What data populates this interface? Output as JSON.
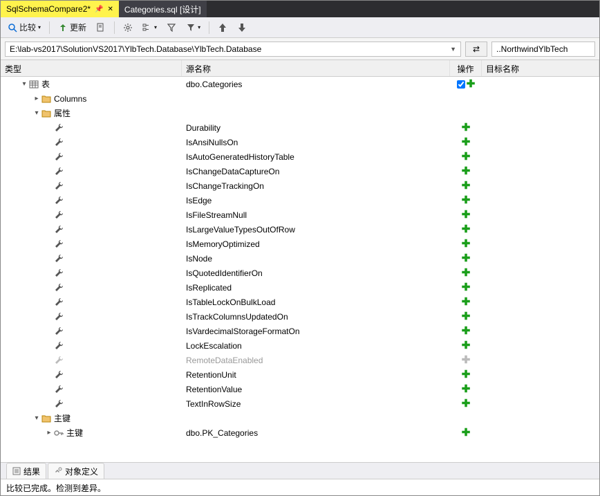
{
  "tabs": [
    {
      "label": "SqlSchemaCompare2*",
      "active": true,
      "pinned": true
    },
    {
      "label": "Categories.sql [设计]",
      "active": false
    }
  ],
  "toolbar": {
    "compare": "比较",
    "update": "更新"
  },
  "paths": {
    "source": "E:\\lab-vs2017\\SolutionVS2017\\YlbTech.Database\\YlbTech.Database",
    "target": "..NorthwindYlbTech"
  },
  "headers": {
    "type": "类型",
    "source": "源名称",
    "action": "操作",
    "target": "目标名称"
  },
  "tree": [
    {
      "depth": 0,
      "expander": "▾",
      "icon": "table-icon",
      "type_label": "表",
      "source": "dbo.Categories",
      "action": "plus",
      "check": true
    },
    {
      "depth": 1,
      "expander": "▸",
      "icon": "folder-icon",
      "type_label": "Columns",
      "source": "",
      "action": ""
    },
    {
      "depth": 1,
      "expander": "▾",
      "icon": "folder-icon",
      "type_label": "属性",
      "source": "",
      "action": ""
    },
    {
      "depth": 2,
      "expander": "",
      "icon": "wrench-icon",
      "type_label": "",
      "source": "Durability",
      "action": "plus"
    },
    {
      "depth": 2,
      "expander": "",
      "icon": "wrench-icon",
      "type_label": "",
      "source": "IsAnsiNullsOn",
      "action": "plus"
    },
    {
      "depth": 2,
      "expander": "",
      "icon": "wrench-icon",
      "type_label": "",
      "source": "IsAutoGeneratedHistoryTable",
      "action": "plus"
    },
    {
      "depth": 2,
      "expander": "",
      "icon": "wrench-icon",
      "type_label": "",
      "source": "IsChangeDataCaptureOn",
      "action": "plus"
    },
    {
      "depth": 2,
      "expander": "",
      "icon": "wrench-icon",
      "type_label": "",
      "source": "IsChangeTrackingOn",
      "action": "plus"
    },
    {
      "depth": 2,
      "expander": "",
      "icon": "wrench-icon",
      "type_label": "",
      "source": "IsEdge",
      "action": "plus"
    },
    {
      "depth": 2,
      "expander": "",
      "icon": "wrench-icon",
      "type_label": "",
      "source": "IsFileStreamNull",
      "action": "plus"
    },
    {
      "depth": 2,
      "expander": "",
      "icon": "wrench-icon",
      "type_label": "",
      "source": "IsLargeValueTypesOutOfRow",
      "action": "plus"
    },
    {
      "depth": 2,
      "expander": "",
      "icon": "wrench-icon",
      "type_label": "",
      "source": "IsMemoryOptimized",
      "action": "plus"
    },
    {
      "depth": 2,
      "expander": "",
      "icon": "wrench-icon",
      "type_label": "",
      "source": "IsNode",
      "action": "plus"
    },
    {
      "depth": 2,
      "expander": "",
      "icon": "wrench-icon",
      "type_label": "",
      "source": "IsQuotedIdentifierOn",
      "action": "plus"
    },
    {
      "depth": 2,
      "expander": "",
      "icon": "wrench-icon",
      "type_label": "",
      "source": "IsReplicated",
      "action": "plus"
    },
    {
      "depth": 2,
      "expander": "",
      "icon": "wrench-icon",
      "type_label": "",
      "source": "IsTableLockOnBulkLoad",
      "action": "plus"
    },
    {
      "depth": 2,
      "expander": "",
      "icon": "wrench-icon",
      "type_label": "",
      "source": "IsTrackColumnsUpdatedOn",
      "action": "plus"
    },
    {
      "depth": 2,
      "expander": "",
      "icon": "wrench-icon",
      "type_label": "",
      "source": "IsVardecimalStorageFormatOn",
      "action": "plus"
    },
    {
      "depth": 2,
      "expander": "",
      "icon": "wrench-icon",
      "type_label": "",
      "source": "LockEscalation",
      "action": "plus"
    },
    {
      "depth": 2,
      "expander": "",
      "icon": "wrench-icon-gray",
      "type_label": "",
      "source": "RemoteDataEnabled",
      "action": "plus-gray",
      "muted": true
    },
    {
      "depth": 2,
      "expander": "",
      "icon": "wrench-icon",
      "type_label": "",
      "source": "RetentionUnit",
      "action": "plus"
    },
    {
      "depth": 2,
      "expander": "",
      "icon": "wrench-icon",
      "type_label": "",
      "source": "RetentionValue",
      "action": "plus"
    },
    {
      "depth": 2,
      "expander": "",
      "icon": "wrench-icon",
      "type_label": "",
      "source": "TextInRowSize",
      "action": "plus"
    },
    {
      "depth": 1,
      "expander": "▾",
      "icon": "folder-icon",
      "type_label": "主键",
      "source": "",
      "action": ""
    },
    {
      "depth": 2,
      "expander": "▸",
      "icon": "key-icon",
      "type_label": "主键",
      "source": "dbo.PK_Categories",
      "action": "plus"
    }
  ],
  "bottom_tabs": {
    "results": "结果",
    "object_def": "对象定义"
  },
  "status": "比较已完成。检测到差异。"
}
